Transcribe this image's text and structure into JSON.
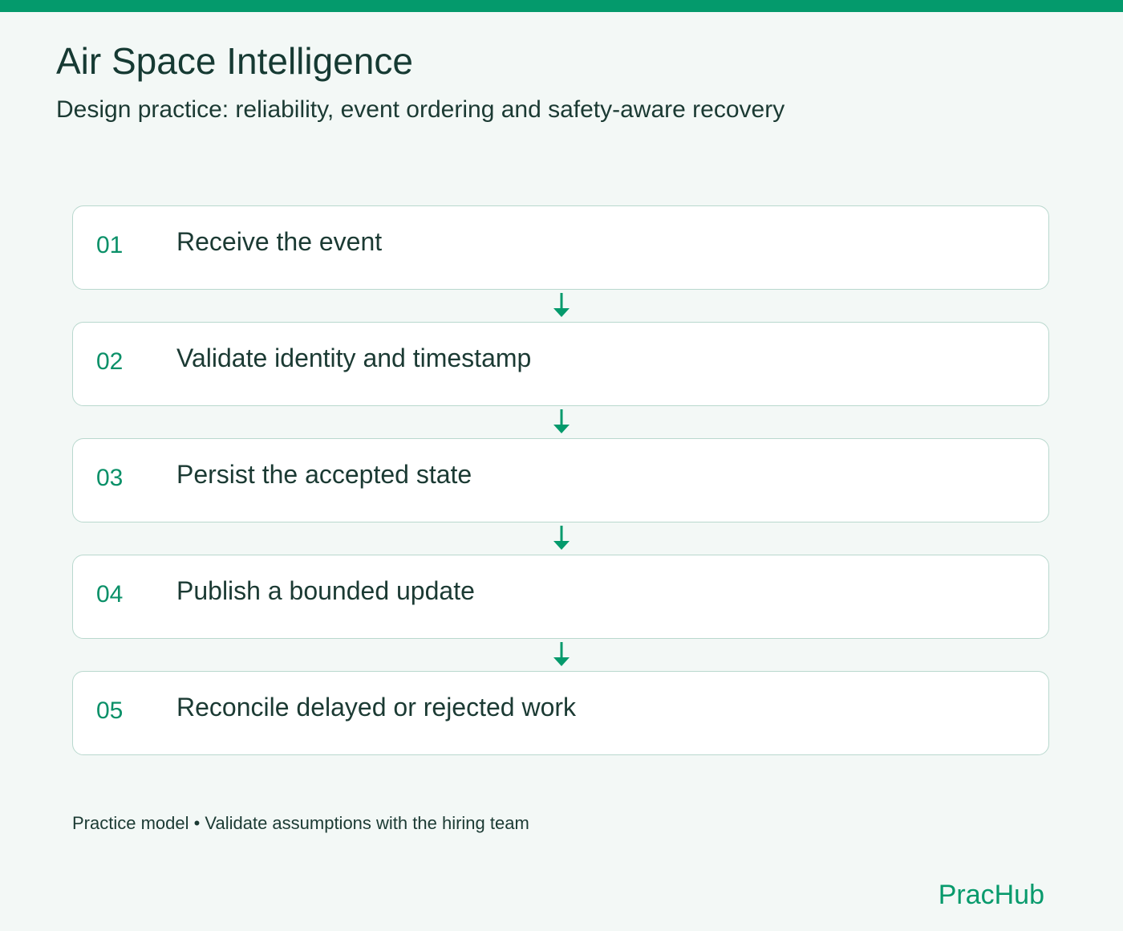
{
  "header": {
    "title": "Air Space Intelligence",
    "subtitle": "Design practice: reliability, event ordering and safety-aware recovery"
  },
  "steps": [
    {
      "number": "01",
      "label": "Receive the event"
    },
    {
      "number": "02",
      "label": "Validate identity and timestamp"
    },
    {
      "number": "03",
      "label": "Persist the accepted state"
    },
    {
      "number": "04",
      "label": "Publish a bounded update"
    },
    {
      "number": "05",
      "label": "Reconcile delayed or rejected work"
    }
  ],
  "footer": {
    "note": "Practice model • Validate assumptions with the hiring team",
    "brand": "PracHub"
  },
  "colors": {
    "accent": "#049a6c",
    "background": "#f3f8f6",
    "card_border": "#b9d8ce",
    "text": "#1b3a33"
  }
}
